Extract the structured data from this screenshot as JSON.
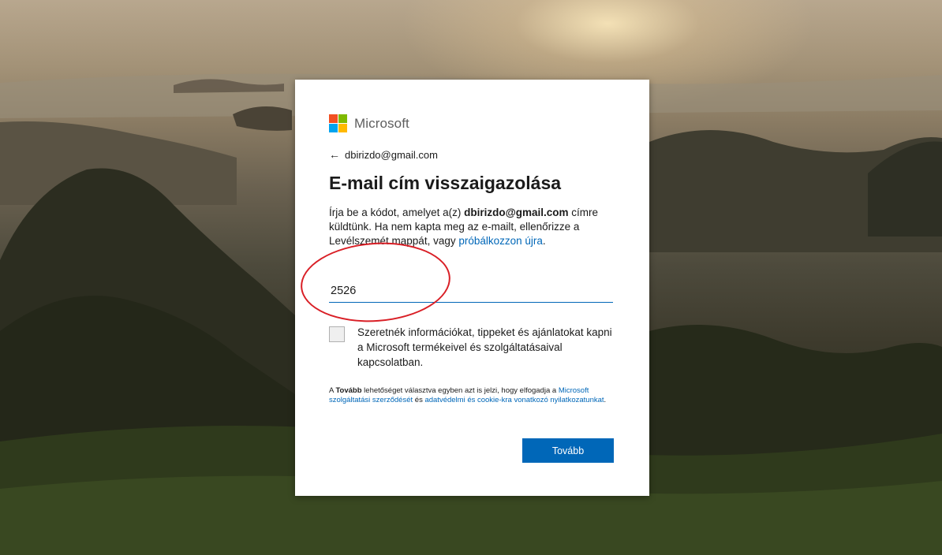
{
  "brand": {
    "name": "Microsoft",
    "colors": {
      "red": "#f25022",
      "green": "#7fba00",
      "blue": "#00a4ef",
      "yellow": "#ffb900"
    },
    "accent": "#0067b8"
  },
  "back": {
    "icon": "arrow-left-icon",
    "arrow": "←",
    "email": "dbirizdo@gmail.com"
  },
  "title": "E-mail cím visszaigazolása",
  "description": {
    "part1": "Írja be a kódot, amelyet a(z) ",
    "email": "dbirizdo@gmail.com",
    "part2": " címre küldtünk. Ha nem kapta meg az e-mailt, ellenőrizze a Levélszemét mappát, vagy ",
    "retry_link": "próbálkozzon újra",
    "part3": "."
  },
  "code_input": {
    "value": "2526",
    "placeholder": ""
  },
  "annotation": {
    "color": "#d91f26"
  },
  "consent": {
    "checked": false,
    "label": "Szeretnék információkat, tippeket és ajánlatokat kapni a Microsoft termékeivel és szolgáltatásaival kapcsolatban."
  },
  "legal": {
    "part1": "A ",
    "bold": "Tovább",
    "part2": " lehetőséget választva egyben azt is jelzi, hogy elfogadja a ",
    "link1": "Microsoft szolgáltatási szerződését",
    "part3": " és ",
    "link2": "adatvédelmi és cookie-kra vonatkozó nyilatkozatunkat",
    "part4": "."
  },
  "next_button": "Tovább"
}
